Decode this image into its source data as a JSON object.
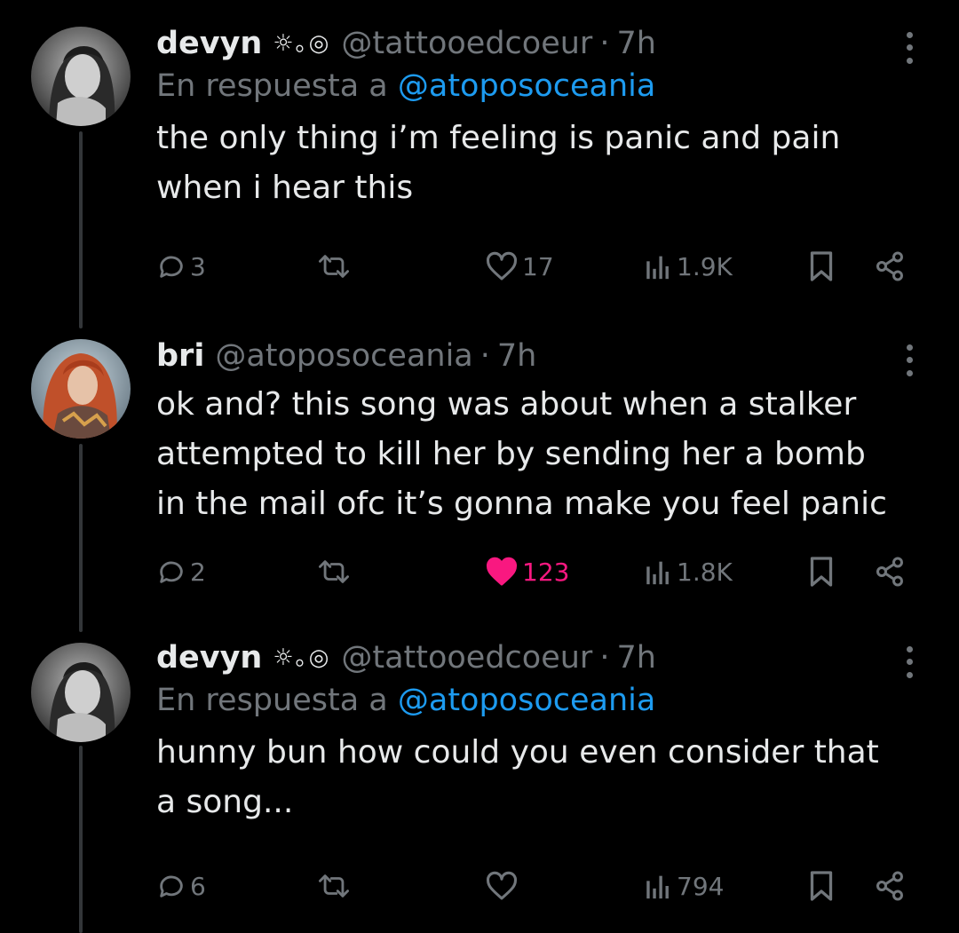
{
  "tweets": [
    {
      "name": "devyn",
      "emoji": "☼｡◎",
      "handle": "@tattooedcoeur",
      "sep": "·",
      "time": "7h",
      "reply_prefix": "En respuesta a",
      "reply_mention": "@atoposoceania",
      "text_lines": [
        "the only thing i’m feeling is panic and pain",
        "when i hear this"
      ],
      "replies": "3",
      "likes": "17",
      "views": "1.9K",
      "liked": false
    },
    {
      "name": "bri",
      "handle": "@atoposoceania",
      "sep": "·",
      "time": "7h",
      "text_lines": [
        "ok and? this song was about when a stalker",
        "attempted to kill her by sending her a bomb",
        "in the mail ofc it’s gonna make you feel panic"
      ],
      "replies": "2",
      "likes": "123",
      "views": "1.8K",
      "liked": true
    },
    {
      "name": "devyn",
      "emoji": "☼｡◎",
      "handle": "@tattooedcoeur",
      "sep": "·",
      "time": "7h",
      "reply_prefix": "En respuesta a",
      "reply_mention": "@atoposoceania",
      "text_lines": [
        "hunny bun how could you even consider that",
        "a song..."
      ],
      "replies": "6",
      "likes": "",
      "views": "794",
      "liked": false
    }
  ],
  "icons": {
    "reply": "speech-bubble-icon",
    "retweet": "retweet-icon",
    "like": "heart-icon",
    "views": "bar-chart-icon",
    "bookmark": "bookmark-icon",
    "share": "share-icon",
    "more": "more-dots-icon"
  },
  "colors": {
    "background": "#000000",
    "text": "#e7e9ea",
    "secondary": "#71767b",
    "link": "#1d9bf0",
    "like_active": "#f91880",
    "thread_line": "#333639"
  }
}
